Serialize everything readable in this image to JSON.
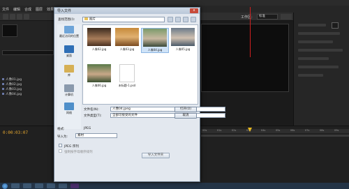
{
  "host": {
    "menu": [
      "文件",
      "编辑",
      "合成",
      "图层",
      "效果",
      "动画",
      "视图",
      "窗口",
      "帮助"
    ],
    "workspace_label": "工作区:",
    "workspace_value": "标准",
    "timecode": "0:00:03:07",
    "project_items": [
      "人像01.jpg",
      "人像02.jpg",
      "人像03.jpg",
      "人像04.jpg"
    ],
    "ruler_labels": [
      "00s",
      "01s",
      "02s",
      "03s",
      "04s",
      "05s",
      "06s",
      "07s",
      "08s",
      "09s"
    ],
    "timeline_progress": 0.33
  },
  "dialog": {
    "title": "导入文件",
    "close": "x",
    "look_in_label": "查找范围(I):",
    "look_in_value": "图片",
    "places": [
      {
        "label": "最近访问的位置",
        "icon": "recent-places-icon"
      },
      {
        "label": "桌面",
        "icon": "desktop-icon"
      },
      {
        "label": "库",
        "icon": "library-icon"
      },
      {
        "label": "计算机",
        "icon": "computer-icon"
      },
      {
        "label": "网络",
        "icon": "network-icon"
      }
    ],
    "files": [
      {
        "name": "人像02.jpg",
        "kind": "image"
      },
      {
        "name": "人像03.jpg",
        "kind": "image"
      },
      {
        "name": "人像04.jpg",
        "kind": "image",
        "selected": true
      },
      {
        "name": "人像05.jpg",
        "kind": "image"
      },
      {
        "name": "人像06.jpg",
        "kind": "image"
      },
      {
        "name": "未标题-1.psd",
        "kind": "document"
      }
    ],
    "file_name_label": "文件名(N):",
    "file_name_value": "人像04.jpeg",
    "file_type_label": "文件类型(T):",
    "file_type_value": "全部可接受的文件",
    "open_button": "打开(O)",
    "cancel_button": "取消",
    "format_label": "格式:",
    "format_value": "JPEG",
    "import_as_label": "导入为:",
    "import_as_value": "素材",
    "sequence_label": "JPEG 序列",
    "force_alpha_label": "强制按字母顺序排列",
    "import_folder_button": "导入文件夹"
  }
}
